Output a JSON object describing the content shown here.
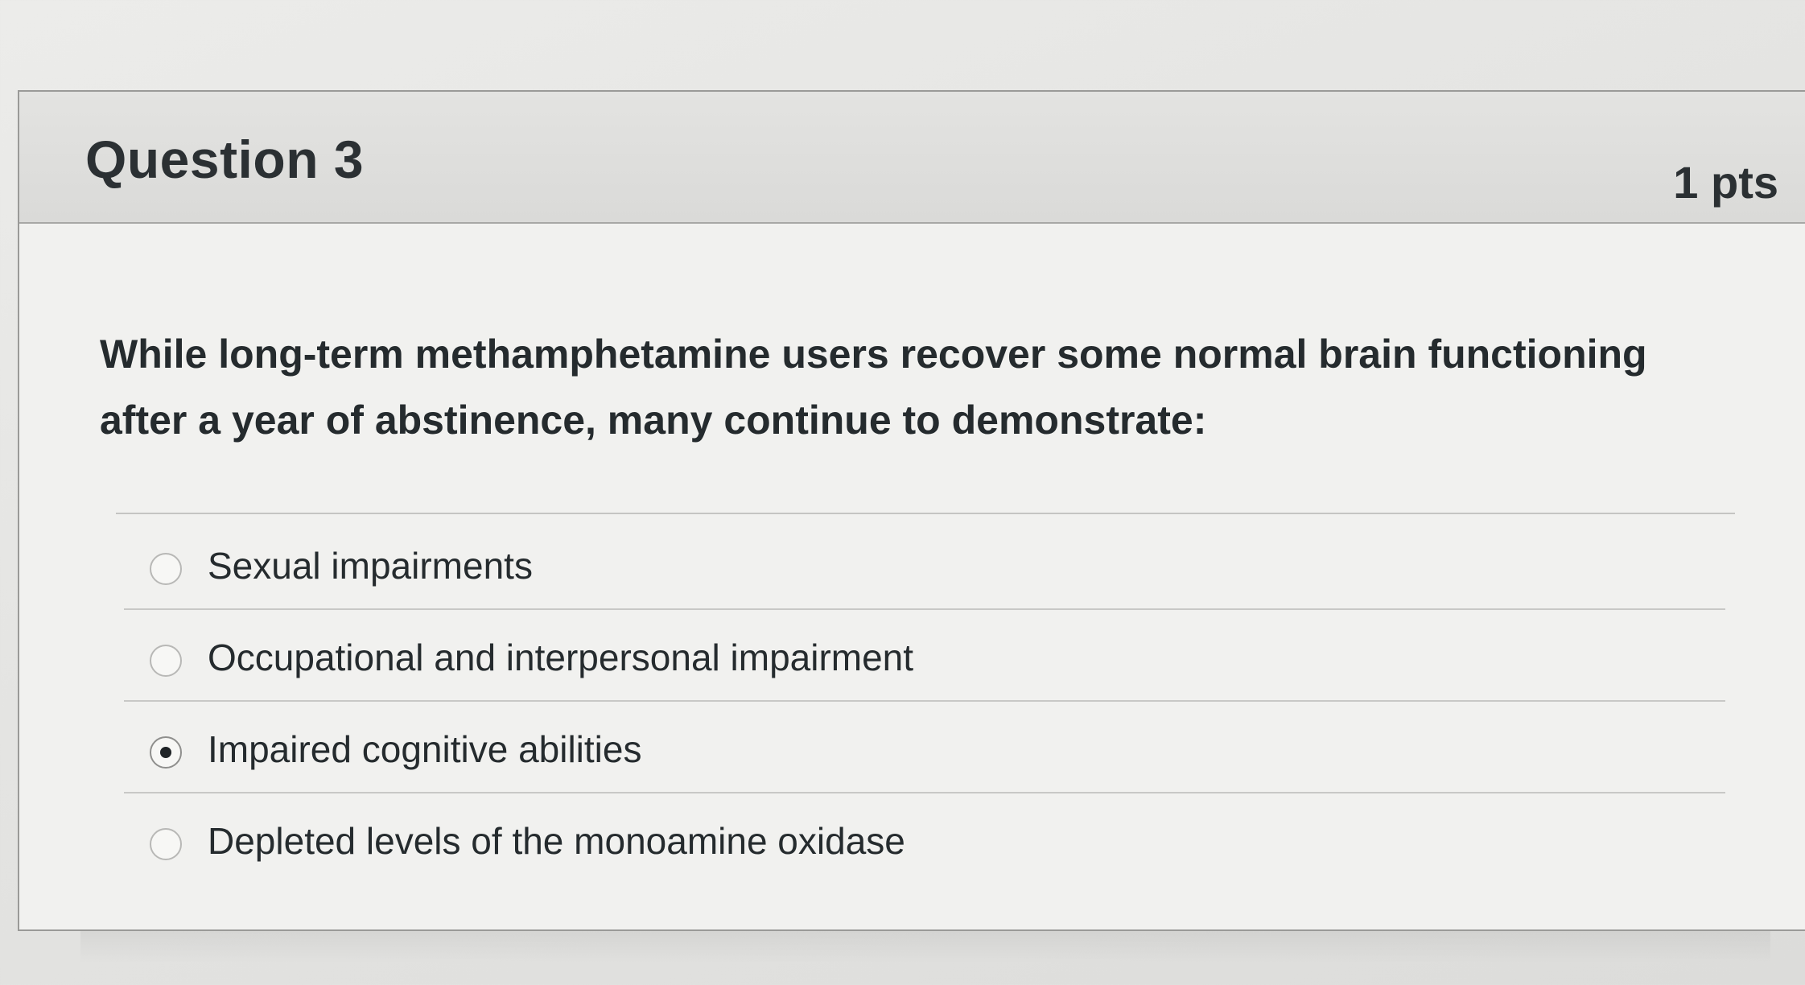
{
  "question": {
    "title": "Question 3",
    "points": "1 pts",
    "text": "While long-term methamphetamine users recover some normal brain functioning after a year of abstinence, many continue to demonstrate:"
  },
  "answers": [
    {
      "label": "Sexual impairments",
      "selected": false
    },
    {
      "label": "Occupational and interpersonal impairment",
      "selected": false
    },
    {
      "label": "Impaired cognitive abilities",
      "selected": true
    },
    {
      "label": "Depleted levels of the monoamine oxidase",
      "selected": false
    }
  ],
  "colors": {
    "text": "#252b2e",
    "header_bg": "#dedede",
    "card_bg": "#f1f1ef"
  }
}
